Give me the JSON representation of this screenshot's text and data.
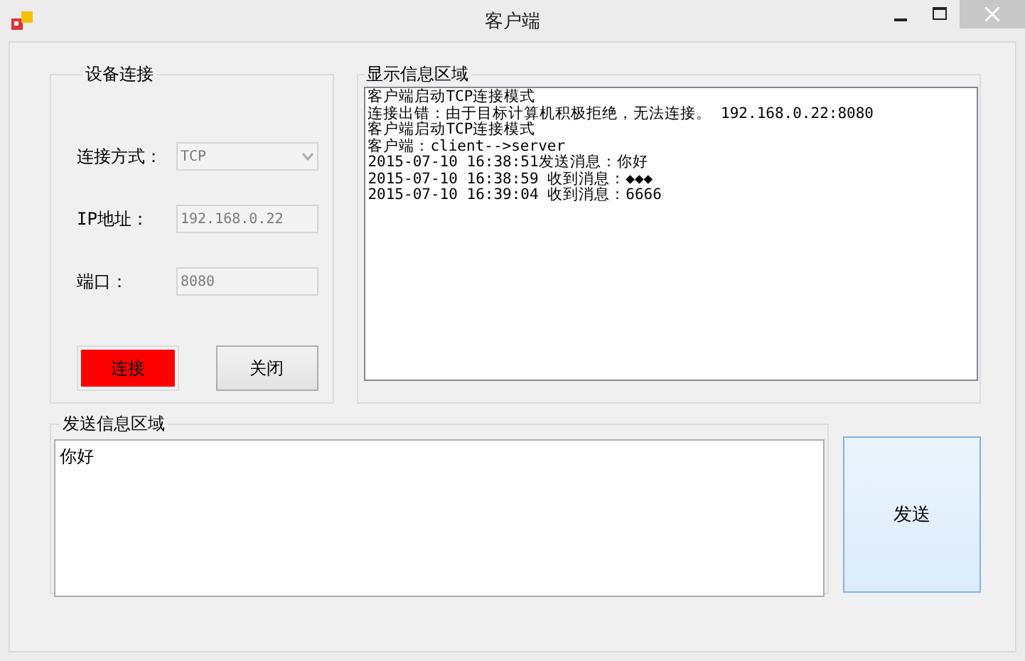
{
  "window": {
    "title": "客户端"
  },
  "connection_group": {
    "title": "设备连接",
    "fields": [
      {
        "kind": "select",
        "label": "连接方式：",
        "value": "TCP",
        "disabled": true
      },
      {
        "kind": "text",
        "label": "IP地址：",
        "value": "192.168.0.22",
        "disabled": true
      },
      {
        "kind": "text",
        "label": "端口：",
        "value": "8080",
        "disabled": true
      }
    ],
    "buttons": [
      {
        "label": "连接",
        "kind": "danger"
      },
      {
        "label": "关闭",
        "kind": "normal"
      }
    ]
  },
  "display_group": {
    "title": "显示信息区域",
    "lines": [
      "客户端启动TCP连接模式",
      "连接出错：由于目标计算机积极拒绝，无法连接。 192.168.0.22:8080",
      "客户端启动TCP连接模式",
      "客户端：client-->server",
      "2015-07-10 16:38:51发送消息：你好",
      "2015-07-10 16:38:59 收到消息：◆◆◆",
      "2015-07-10 16:39:04 收到消息：6666"
    ]
  },
  "send_group": {
    "title": "发送信息区域",
    "value": "你好"
  },
  "send_button": {
    "label": "发送"
  }
}
